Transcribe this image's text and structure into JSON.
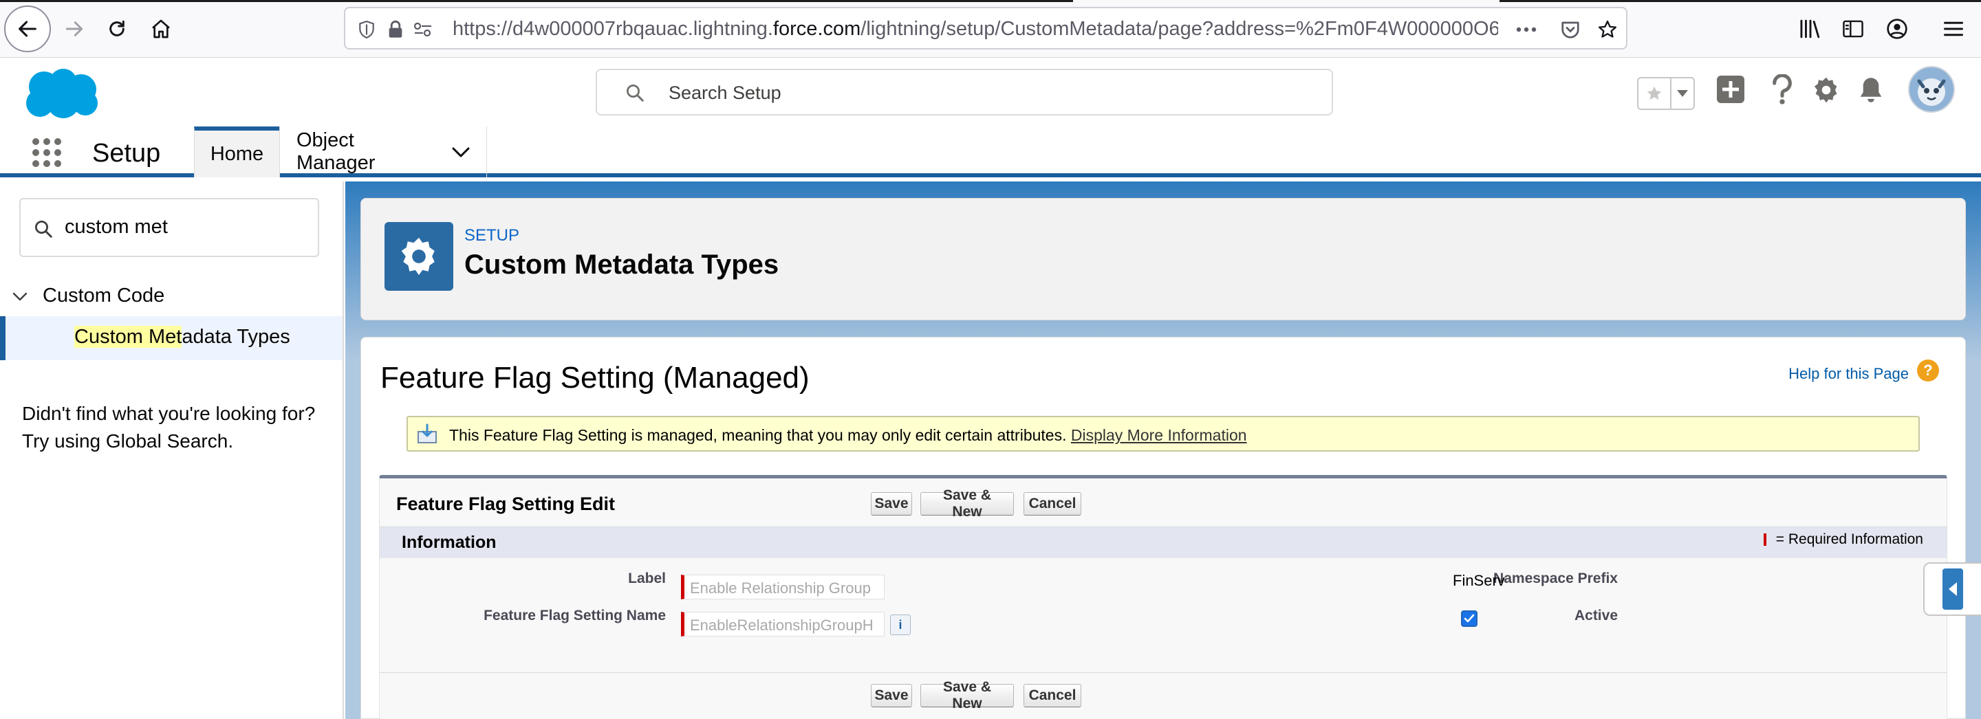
{
  "browser": {
    "url_prefix": "https://d4w000007rbqauac.lightning.",
    "url_host": "force.com",
    "url_suffix": "/lightning/setup/CustomMetadata/page?address=%2Fm0F4W000000O6"
  },
  "header": {
    "search_placeholder": "Search Setup"
  },
  "app_nav": {
    "app_name": "Setup",
    "tabs": [
      {
        "label": "Home"
      },
      {
        "label": "Object Manager"
      }
    ]
  },
  "sidebar": {
    "quick_find_value": "custom met",
    "tree_parent": "Custom Code",
    "tree_child_highlight": "Custom Met",
    "tree_child_rest": "adata Types",
    "not_found_text": "Didn't find what you're looking for? Try using Global Search."
  },
  "page_header": {
    "eyebrow": "SETUP",
    "title": "Custom Metadata Types"
  },
  "record": {
    "title": "Feature Flag Setting (Managed)",
    "help_link": "Help for this Page",
    "help_icon_glyph": "?",
    "managed_message": "This Feature Flag Setting is managed, meaning that you may only edit certain attributes. ",
    "managed_link": "Display More Information",
    "edit_title": "Feature Flag Setting Edit",
    "buttons": {
      "save": "Save",
      "save_new": "Save & New",
      "cancel": "Cancel"
    },
    "section_title": "Information",
    "required_legend": "= Required Information",
    "fields": {
      "label_label": "Label",
      "label_value": "Enable Relationship Group",
      "name_label": "Feature Flag Setting Name",
      "name_value": "EnableRelationshipGroupH",
      "info_glyph": "i",
      "namespace_label": "Namespace Prefix",
      "namespace_value": "FinServ",
      "active_label": "Active",
      "active_checked": true
    }
  },
  "colors": {
    "brand_blue": "#1b5f9e",
    "salesforce_cloud": "#00a1e0",
    "required_red": "#cc0000",
    "help_orange": "#f0a11b",
    "message_yellow": "#ffffd0"
  }
}
